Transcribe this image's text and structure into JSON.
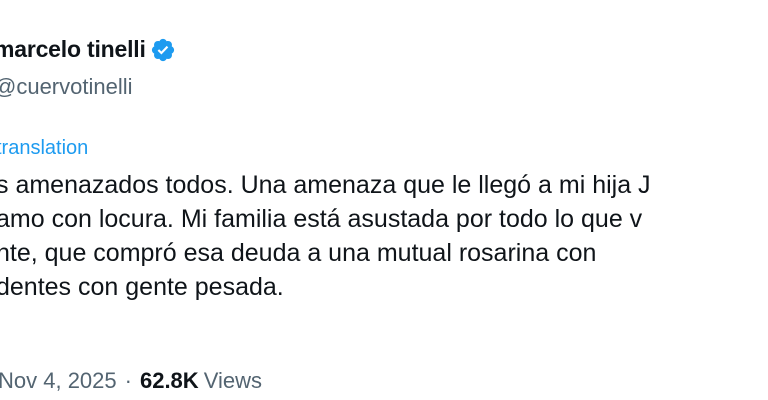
{
  "author": {
    "display_name": "marcelo tinelli",
    "handle": "@cuervotinelli",
    "verified_icon": "verified-badge-icon",
    "verified_color": "#1d9bf0"
  },
  "translation_label": "translation",
  "body_lines": [
    "s amenazados todos. Una amenaza que le llegó a mi hija J",
    "amo con locura. Mi familia está asustada por todo lo que v",
    "nte, que compró esa deuda a una mutual rosarina con",
    "dentes con gente pesada."
  ],
  "meta": {
    "time": "Nov 4, 2025",
    "separator": "·",
    "views_count": "62.8K",
    "views_label": "Views"
  },
  "colors": {
    "text": "#0f1419",
    "secondary": "#536471",
    "accent": "#1d9bf0"
  }
}
